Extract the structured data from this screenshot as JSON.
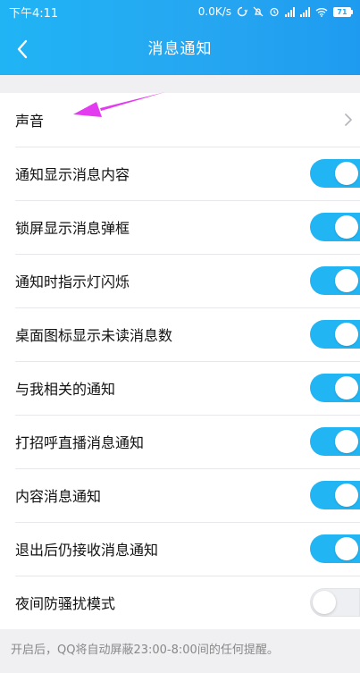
{
  "status_bar": {
    "time": "下午4:11",
    "net_speed": "0.0K/s",
    "battery": "71"
  },
  "nav": {
    "title": "消息通知",
    "back_icon": "chevron-left-icon"
  },
  "settings": [
    {
      "label": "声音",
      "control": "chevron"
    },
    {
      "label": "通知显示消息内容",
      "control": "toggle",
      "on": true
    },
    {
      "label": "锁屏显示消息弹框",
      "control": "toggle",
      "on": true
    },
    {
      "label": "通知时指示灯闪烁",
      "control": "toggle",
      "on": true
    },
    {
      "label": "桌面图标显示未读消息数",
      "control": "toggle",
      "on": true
    },
    {
      "label": "与我相关的通知",
      "control": "toggle",
      "on": true
    },
    {
      "label": "打招呼直播消息通知",
      "control": "toggle",
      "on": true
    },
    {
      "label": "内容消息通知",
      "control": "toggle",
      "on": true
    },
    {
      "label": "退出后仍接收消息通知",
      "control": "toggle",
      "on": true
    },
    {
      "label": "夜间防骚扰模式",
      "control": "toggle",
      "on": false
    }
  ],
  "footer_hint": "开启后，QQ将自动屏蔽23:00-8:00间的任何提醒。",
  "colors": {
    "header": "#22a9f2",
    "toggle_on": "#22b5f3",
    "annotation_arrow": "#e33cf0"
  }
}
